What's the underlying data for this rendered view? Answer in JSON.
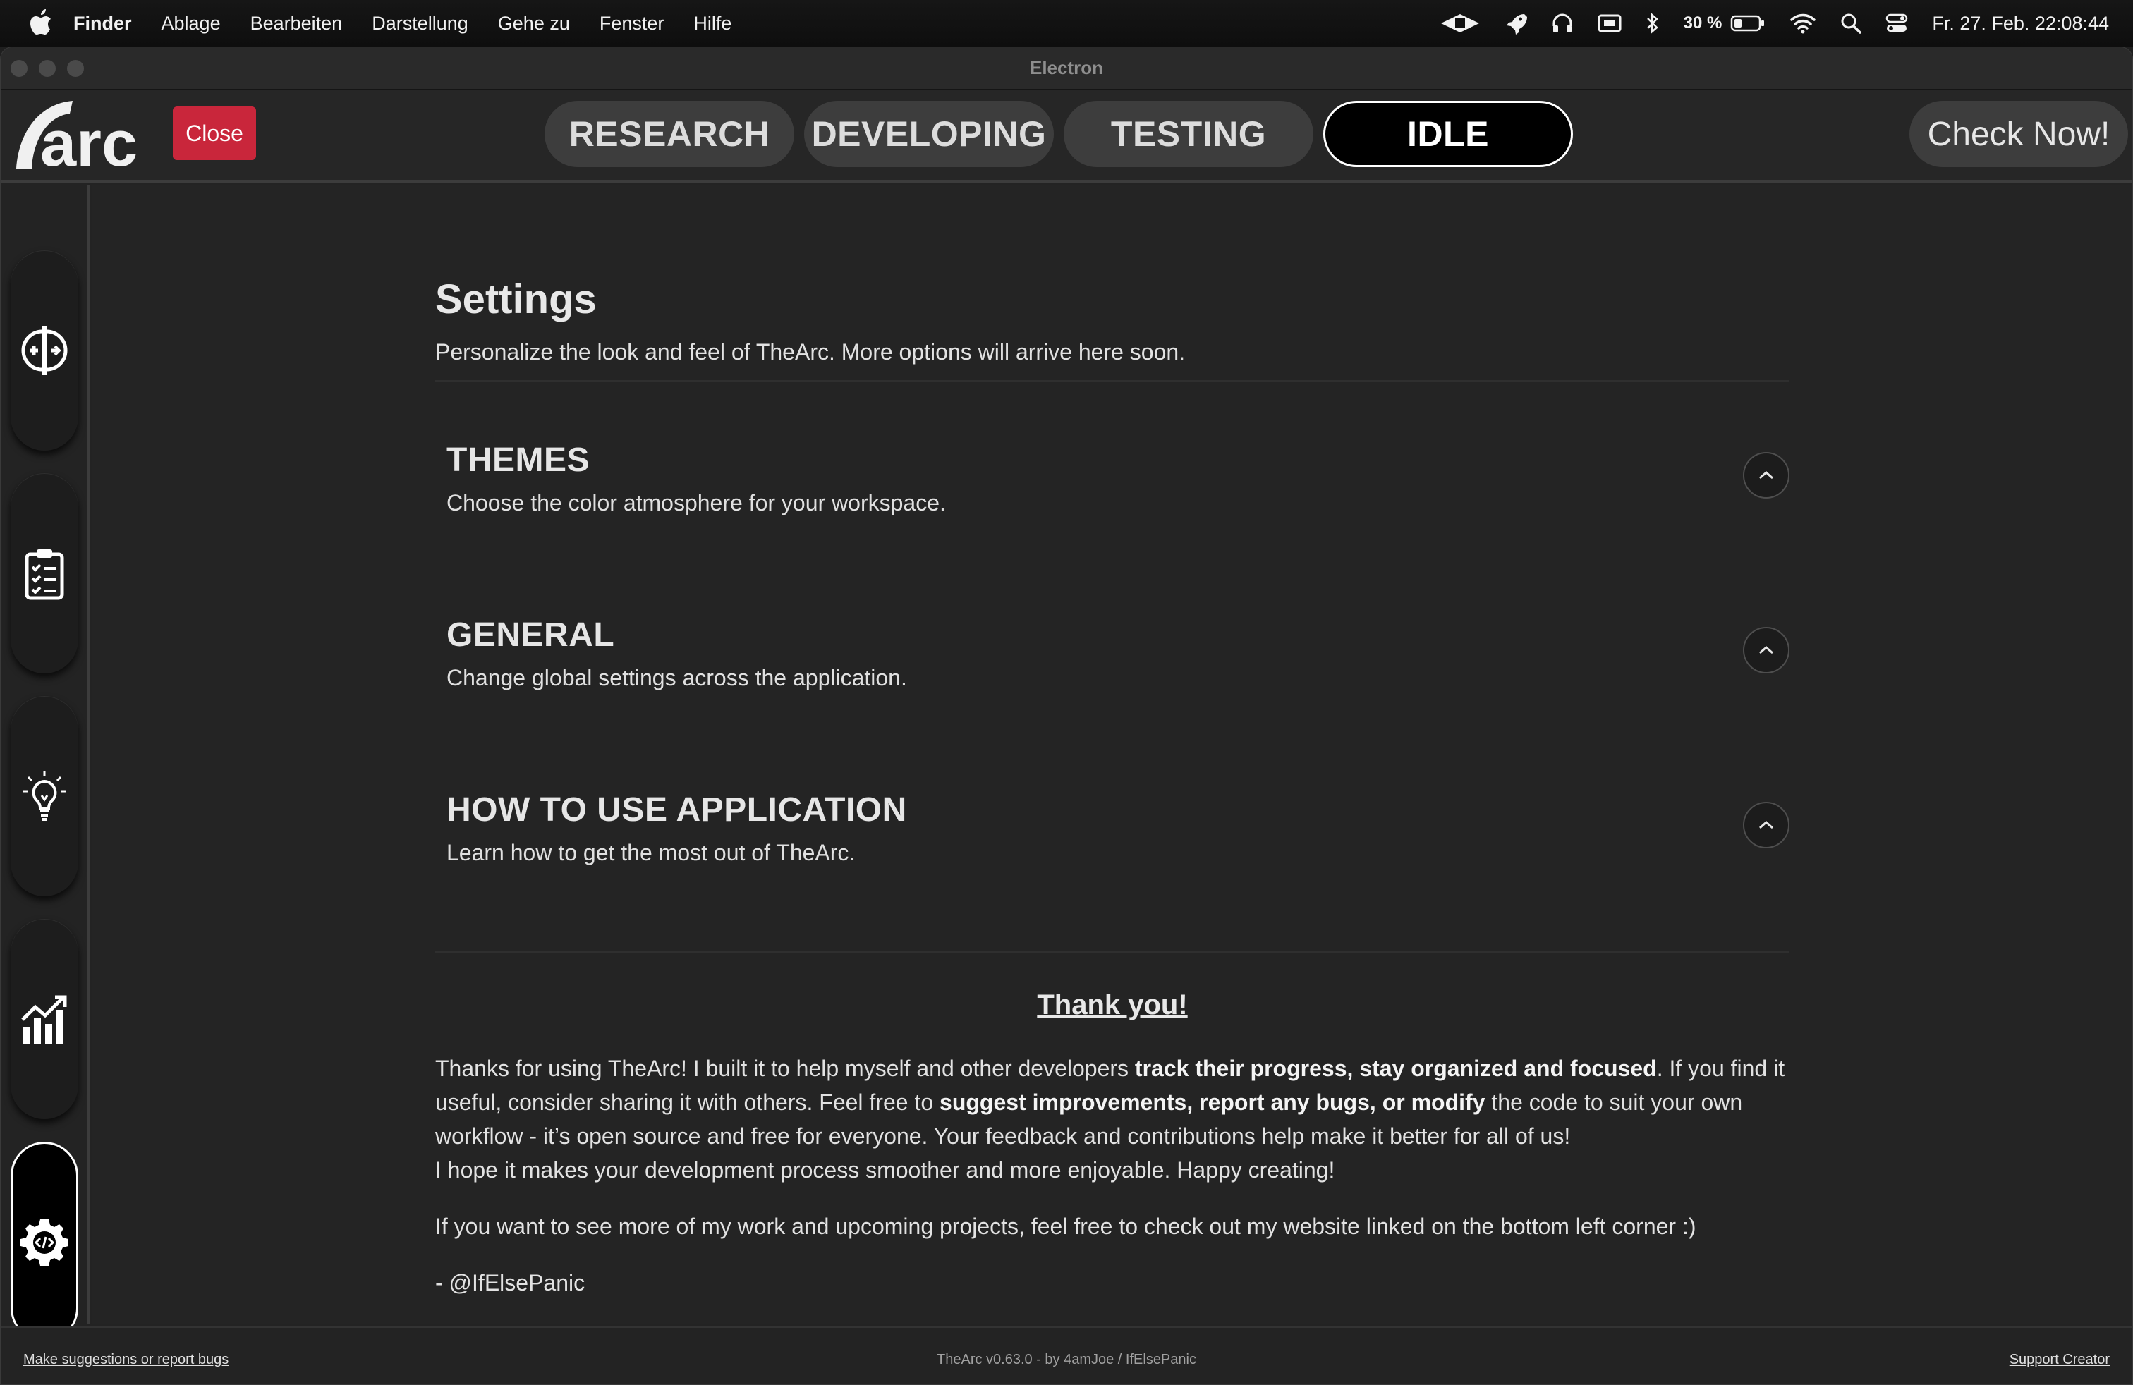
{
  "menubar": {
    "app": "Finder",
    "items": [
      "Ablage",
      "Bearbeiten",
      "Darstellung",
      "Gehe zu",
      "Fenster",
      "Hilfe"
    ],
    "battery": "30 %",
    "datetime": "Fr. 27. Feb.  22:08:44"
  },
  "window": {
    "title": "Electron"
  },
  "header": {
    "logo_text": "arc",
    "close_label": "Close",
    "tabs": [
      {
        "label": "RESEARCH",
        "active": false
      },
      {
        "label": "DEVELOPING",
        "active": false
      },
      {
        "label": "TESTING",
        "active": false
      },
      {
        "label": "IDLE",
        "active": true
      }
    ],
    "check_label": "Check Now!"
  },
  "sidebar": {
    "items": [
      {
        "name": "compare-icon"
      },
      {
        "name": "clipboard-checklist-icon"
      },
      {
        "name": "lightbulb-icon"
      },
      {
        "name": "chart-growth-icon"
      },
      {
        "name": "gear-code-icon",
        "active": true
      }
    ]
  },
  "settings": {
    "title": "Settings",
    "subtitle": "Personalize the look and feel of TheArc. More options will arrive here soon.",
    "sections": [
      {
        "title": "THEMES",
        "desc": "Choose the color atmosphere for your workspace."
      },
      {
        "title": "GENERAL",
        "desc": "Change global settings across the application."
      },
      {
        "title": "HOW TO USE APPLICATION",
        "desc": "Learn how to get the most out of TheArc."
      }
    ]
  },
  "thanks": {
    "title": "Thank you!",
    "p1_a": "Thanks for using TheArc! I built it to help myself and other developers ",
    "p1_b": "track their progress, stay organized and focused",
    "p1_c": ". If you find it useful, consider sharing it with others. Feel free to ",
    "p1_d": "suggest improvements, report any bugs, or modify",
    "p1_e": " the code to suit your own workflow - it’s open source and free for everyone. Your feedback and contributions help make it better for all of us!",
    "p1_f": "I hope it makes your development process smoother and more enjoyable. Happy creating!",
    "p2": "If you want to see more of my work and upcoming projects, feel free to check out my website linked on the bottom left corner :)",
    "signature": "- @IfElsePanic"
  },
  "footer": {
    "left": "Make suggestions or report bugs",
    "center": "TheArc v0.63.0 - by 4amJoe / IfElsePanic",
    "right": "Support Creator"
  }
}
